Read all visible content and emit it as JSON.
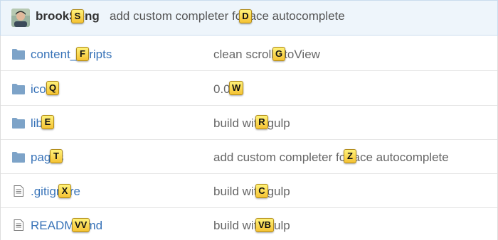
{
  "commit": {
    "author": "brookSong",
    "message": "add custom completer for ace autocomplete"
  },
  "files": [
    {
      "name": "content_scripts",
      "type": "folder",
      "commit_message": "clean scrollIntoView"
    },
    {
      "name": "icons",
      "type": "folder",
      "commit_message": "0.0.1"
    },
    {
      "name": "lib",
      "type": "folder",
      "commit_message": "build with gulp"
    },
    {
      "name": "pages",
      "type": "folder",
      "commit_message": "add custom completer for ace autocomplete"
    },
    {
      "name": ".gitignore",
      "type": "file",
      "commit_message": "build with gulp"
    },
    {
      "name": "README.md",
      "type": "file",
      "commit_message": "build with gulp"
    }
  ],
  "hints": {
    "S": "S",
    "D": "D",
    "F": "F",
    "G": "G",
    "Q": "Q",
    "W": "W",
    "E": "E",
    "R": "R",
    "T": "T",
    "Z": "Z",
    "X": "X",
    "C": "C",
    "VV": "VV",
    "VB": "VB"
  },
  "colors": {
    "link": "#3873b8",
    "folder_icon": "#7da3c8",
    "hint_bg": "#f5c233",
    "commit_bar_bg": "#eef5fb"
  },
  "icons": {
    "folder": "folder-icon",
    "file": "file-text-icon",
    "avatar": "avatar"
  }
}
